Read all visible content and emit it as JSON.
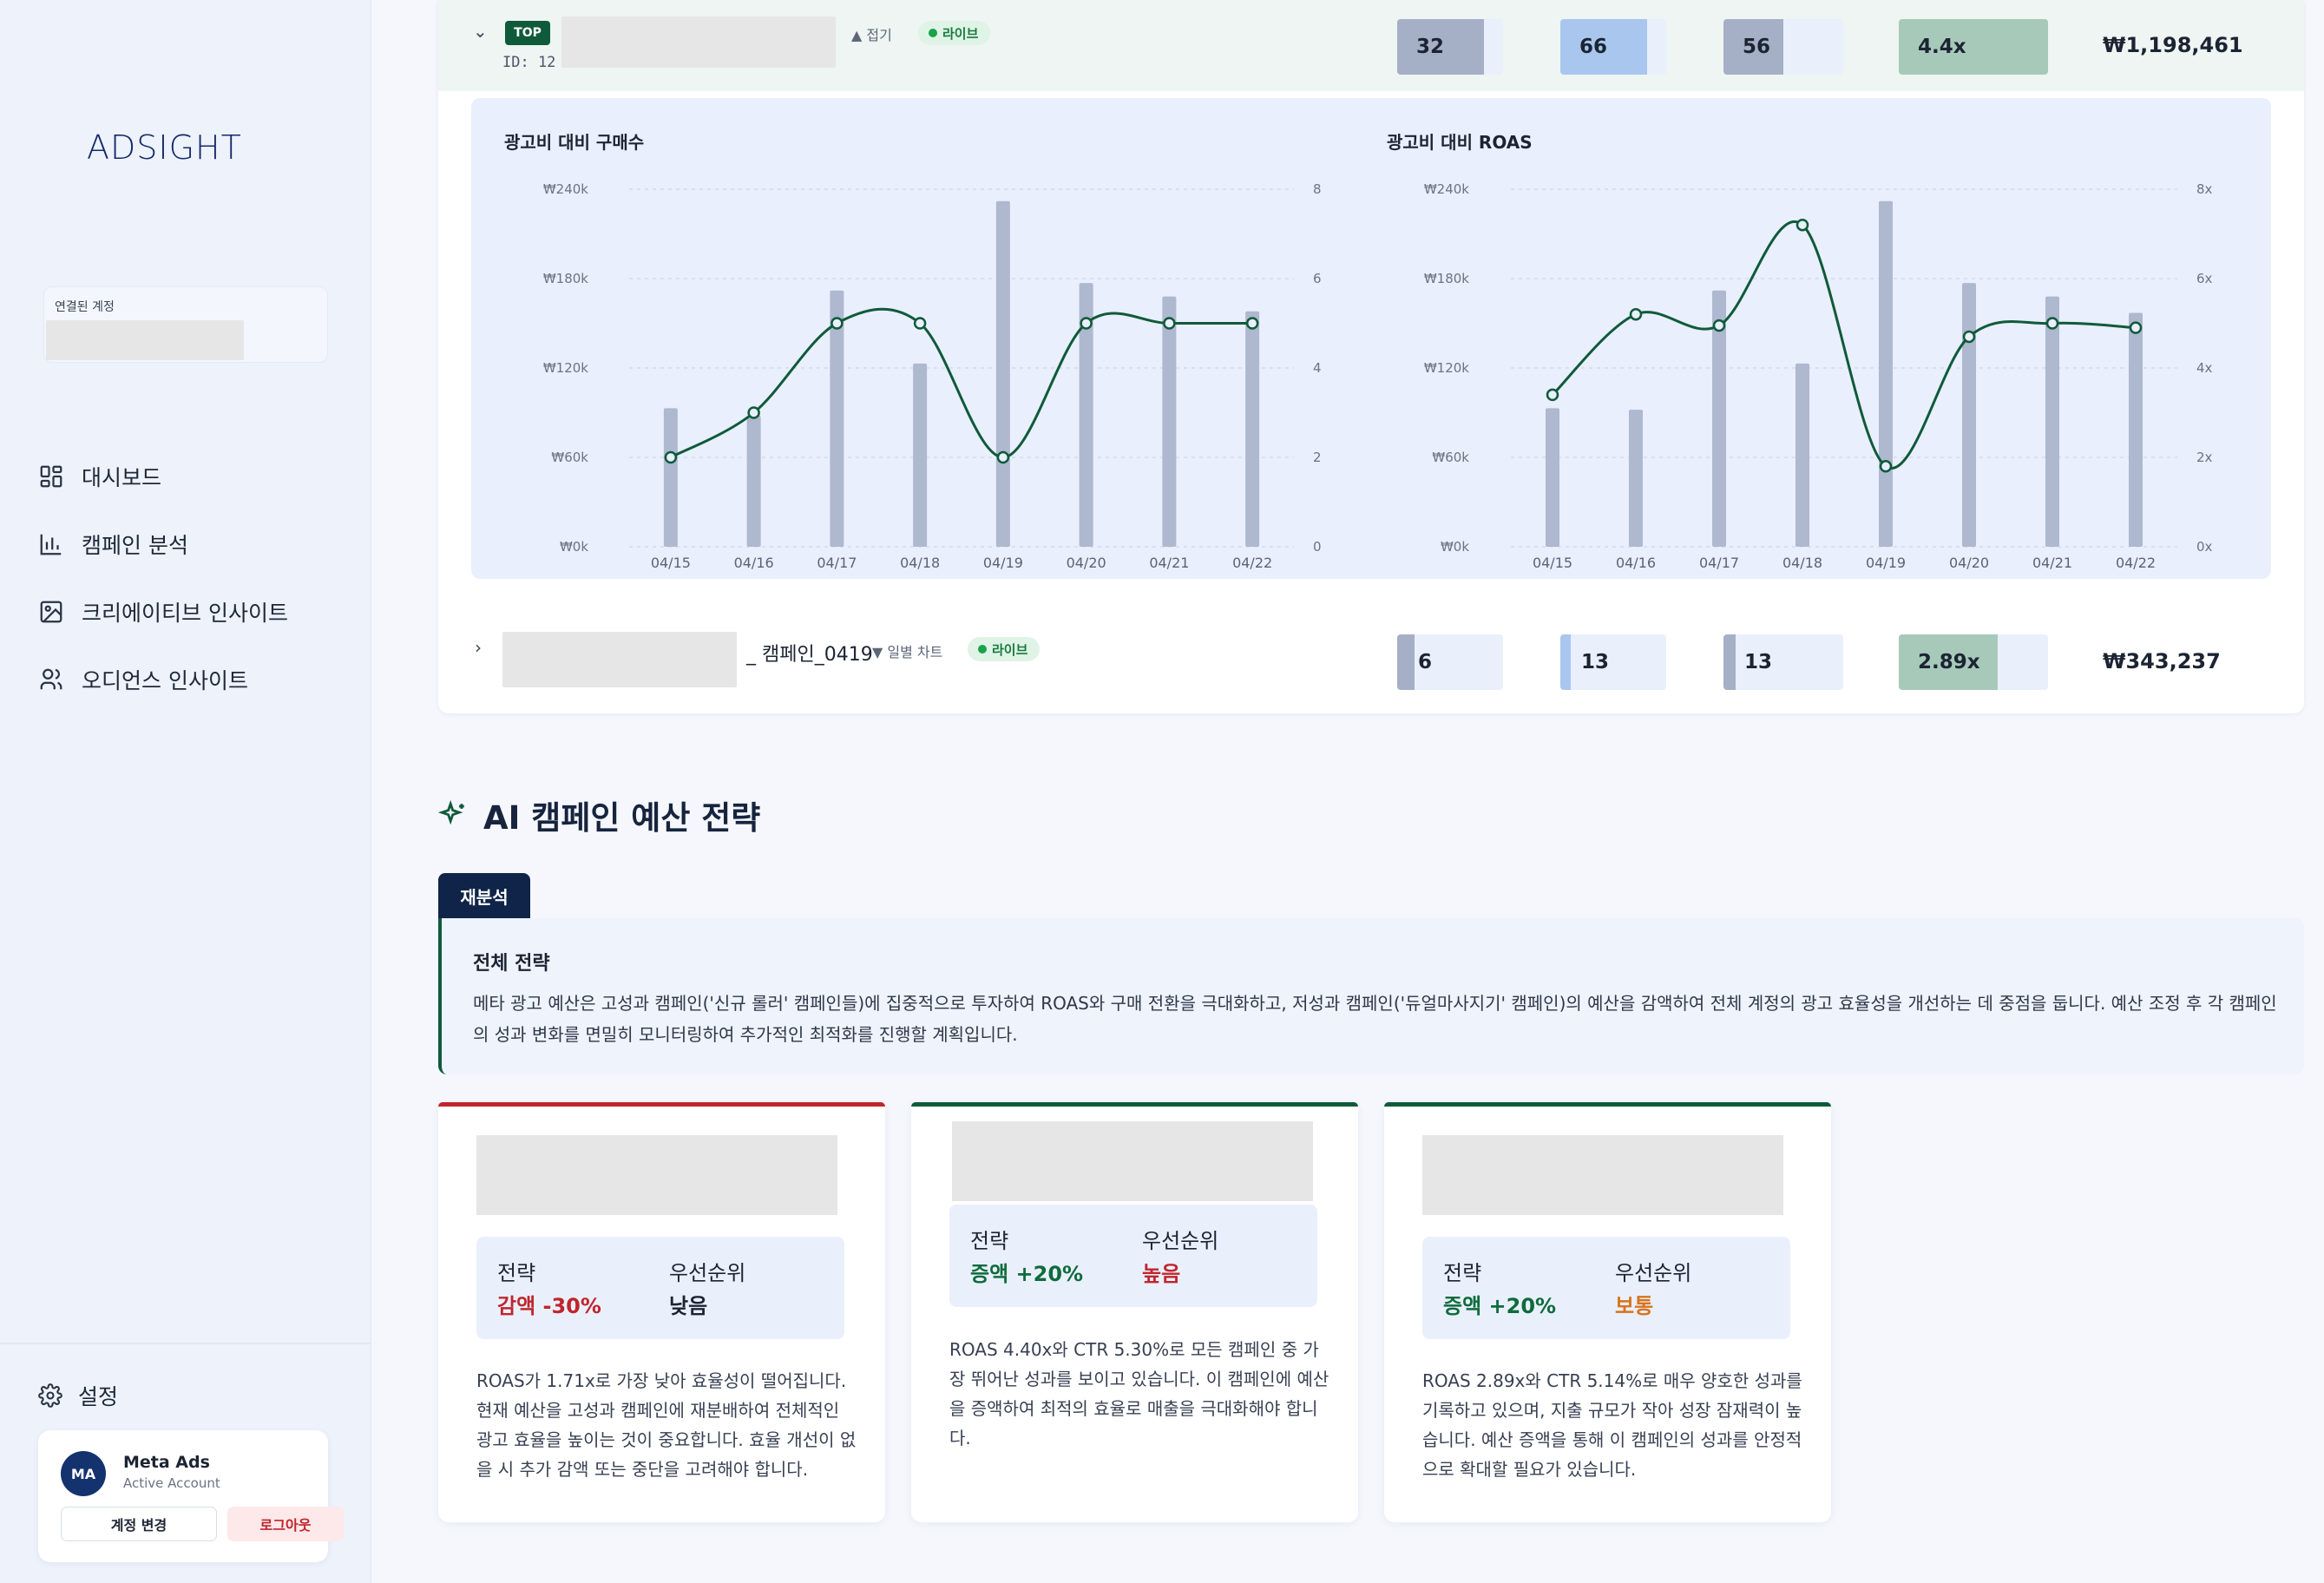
{
  "brand": {
    "logo_text": "ADSIGHT"
  },
  "sidebar": {
    "connected_label": "연결된 계정",
    "nav": [
      {
        "label": "대시보드",
        "icon": "dashboard-icon"
      },
      {
        "label": "캠페인 분석",
        "icon": "bar-chart-icon"
      },
      {
        "label": "크리에이티브 인사이트",
        "icon": "image-icon"
      },
      {
        "label": "오디언스 인사이트",
        "icon": "users-icon"
      }
    ],
    "settings_label": "설정",
    "user": {
      "initials": "MA",
      "name": "Meta Ads",
      "status": "Active Account",
      "switch_label": "계정 변경",
      "logout_label": "로그아웃"
    }
  },
  "campaigns": [
    {
      "badge": "TOP",
      "id_text": "ID: 12",
      "toggle_label": "▲ 접기",
      "status": "라이브",
      "metrics": [
        {
          "value": "32",
          "fill": 0.82,
          "color": "#a5b0c6"
        },
        {
          "value": "66",
          "fill": 0.82,
          "color": "#a9c6ee"
        },
        {
          "value": "56",
          "fill": 0.5,
          "color": "#a5b0c6"
        },
        {
          "value": "4.4x",
          "fill": 1.0,
          "color": "#a7c9b9"
        }
      ],
      "spend": "₩1,198,461"
    },
    {
      "name_suffix": "_ 캠페인_0419",
      "toggle_label": "▼ 일별 차트",
      "status": "라이브",
      "metrics": [
        {
          "value": "6",
          "fill": 0.16,
          "color": "#a5b0c6"
        },
        {
          "value": "13",
          "fill": 0.1,
          "color": "#a9c6ee"
        },
        {
          "value": "13",
          "fill": 0.1,
          "color": "#a5b0c6"
        },
        {
          "value": "2.89x",
          "fill": 0.66,
          "color": "#a7c9b9"
        }
      ],
      "spend": "₩343,237"
    }
  ],
  "chart_data": [
    {
      "type": "bar+line",
      "title": "광고비 대비 구매수",
      "categories": [
        "04/15",
        "04/16",
        "04/17",
        "04/18",
        "04/19",
        "04/20",
        "04/21",
        "04/22"
      ],
      "bar_values": [
        93000,
        88000,
        172000,
        123000,
        232000,
        177000,
        168000,
        158000
      ],
      "line_values": [
        2,
        3,
        5,
        5,
        2,
        5,
        5,
        5
      ],
      "y_left_ticks": [
        "₩0k",
        "₩60k",
        "₩120k",
        "₩180k",
        "₩240k"
      ],
      "y_left_range": [
        0,
        240000
      ],
      "y_right_ticks": [
        "0",
        "2",
        "4",
        "6",
        "8"
      ],
      "y_right_range": [
        0,
        8
      ],
      "grid": true
    },
    {
      "type": "bar+line",
      "title": "광고비 대비 ROAS",
      "categories": [
        "04/15",
        "04/16",
        "04/17",
        "04/18",
        "04/19",
        "04/20",
        "04/21",
        "04/22"
      ],
      "bar_values": [
        93000,
        92000,
        172000,
        123000,
        232000,
        177000,
        168000,
        157000
      ],
      "line_values": [
        3.4,
        5.2,
        4.95,
        7.2,
        1.8,
        4.7,
        5.0,
        4.9
      ],
      "y_left_ticks": [
        "₩0k",
        "₩60k",
        "₩120k",
        "₩180k",
        "₩240k"
      ],
      "y_left_range": [
        0,
        240000
      ],
      "y_right_ticks": [
        "0x",
        "2x",
        "4x",
        "6x",
        "8x"
      ],
      "y_right_range": [
        0,
        8
      ],
      "grid": true
    }
  ],
  "ai": {
    "title": "AI 캠페인 예산 전략",
    "reanalyze_label": "재분석",
    "overall_title": "전체 전략",
    "overall_text": "메타 광고 예산은 고성과 캠페인('신규 롤러' 캠페인들)에 집중적으로 투자하여 ROAS와 구매 전환을 극대화하고, 저성과 캠페인('듀얼마사지기' 캠페인)의 예산을 감액하여 전체 계정의 광고 효율성을 개선하는 데 중점을 둡니다. 예산 조정 후 각 캠페인의 성과 변화를 면밀히 모니터링하여 추가적인 최적화를 진행할 계획입니다.",
    "cards": [
      {
        "accent": "#c0252c",
        "strategy_label": "전략",
        "priority_label": "우선순위",
        "strategy": "감액 -30%",
        "strategy_color": "#c0252c",
        "priority": "낮음",
        "priority_color": "#1c2433",
        "desc": "ROAS가 1.71x로 가장 낮아 효율성이 떨어집니다. 현재 예산을 고성과 캠페인에 재분배하여 전체적인 광고 효율을 높이는 것이 중요합니다. 효율 개선이 없을 시 추가 감액 또는 중단을 고려해야 합니다."
      },
      {
        "accent": "#0f5a3a",
        "strategy_label": "전략",
        "priority_label": "우선순위",
        "strategy": "증액 +20%",
        "strategy_color": "#0f6b3c",
        "priority": "높음",
        "priority_color": "#c0252c",
        "desc": "ROAS 4.40x와 CTR 5.30%로 모든 캠페인 중 가장 뛰어난 성과를 보이고 있습니다. 이 캠페인에 예산을 증액하여 최적의 효율로 매출을 극대화해야 합니다."
      },
      {
        "accent": "#0f5a3a",
        "strategy_label": "전략",
        "priority_label": "우선순위",
        "strategy": "증액 +20%",
        "strategy_color": "#0f6b3c",
        "priority": "보통",
        "priority_color": "#d9731b",
        "desc": "ROAS 2.89x와 CTR 5.14%로 매우 양호한 성과를 기록하고 있으며, 지출 규모가 작아 성장 잠재력이 높습니다. 예산 증액을 통해 이 캠페인의 성과를 안정적으로 확대할 필요가 있습니다."
      }
    ]
  }
}
